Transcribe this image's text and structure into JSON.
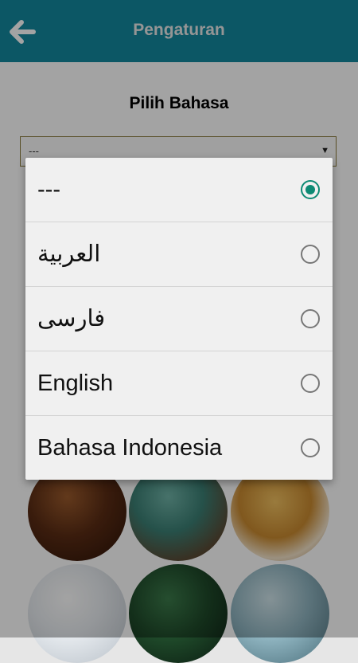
{
  "appbar": {
    "title": "Pengaturan",
    "back_icon": "arrow-left-icon",
    "color": "#14899f"
  },
  "page": {
    "heading": "Pilih Bahasa",
    "select_value": "---"
  },
  "dialog": {
    "options": [
      {
        "label": "---",
        "selected": true
      },
      {
        "label": "العربية",
        "selected": false
      },
      {
        "label": "فارسی",
        "selected": false
      },
      {
        "label": "English",
        "selected": false
      },
      {
        "label": "Bahasa Indonesia",
        "selected": false
      }
    ],
    "accent": "#0d8a74"
  }
}
